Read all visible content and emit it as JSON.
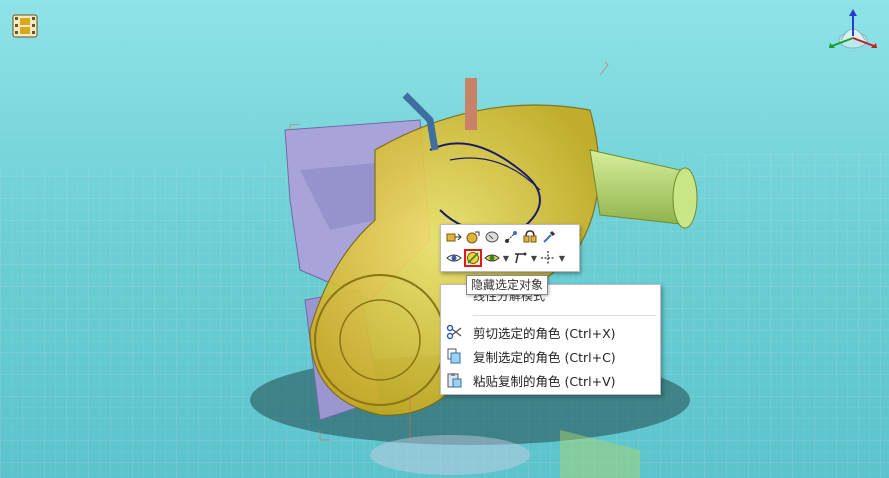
{
  "viewport": {
    "film_button_icon": "film-strip-icon",
    "triad_icon": "view-orientation-triad-icon",
    "background_color": "#6fd0d6",
    "model_colors": {
      "housing": "#a8a4d9",
      "cover": "#e8d12b",
      "shaft": "#b4d66a"
    }
  },
  "mini_toolbar": {
    "row1": [
      "select-next-icon",
      "select-parent-icon",
      "select-similar-icon",
      "transform-icon",
      "group-icon",
      "eyedropper-icon"
    ],
    "row2": [
      "eye-icon",
      "hide-selected-icon",
      "isolate-icon",
      "arrow-tool-icon",
      "move-icon"
    ],
    "active_icon": "hide-selected-icon"
  },
  "tooltip": {
    "text": "隐藏选定对象"
  },
  "context_menu": {
    "partial_item": "线性分解模式",
    "items": [
      {
        "label": "剪切选定的角色 (Ctrl+X)",
        "icon": "scissors-icon"
      },
      {
        "label": "复制选定的角色 (Ctrl+C)",
        "icon": "copy-icon"
      },
      {
        "label": "粘贴复制的角色 (Ctrl+V)",
        "icon": "paste-icon"
      }
    ]
  }
}
